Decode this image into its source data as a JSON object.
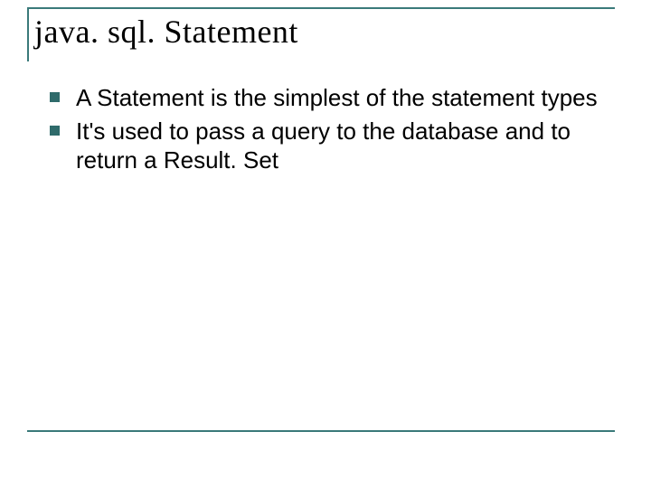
{
  "title": "java. sql. Statement",
  "bullets": [
    "A Statement is the simplest of the statement types",
    "It's used to pass a query to the database and to return a Result. Set"
  ],
  "colors": {
    "accent": "#3a7a7a",
    "bullet": "#2f6b6b"
  }
}
